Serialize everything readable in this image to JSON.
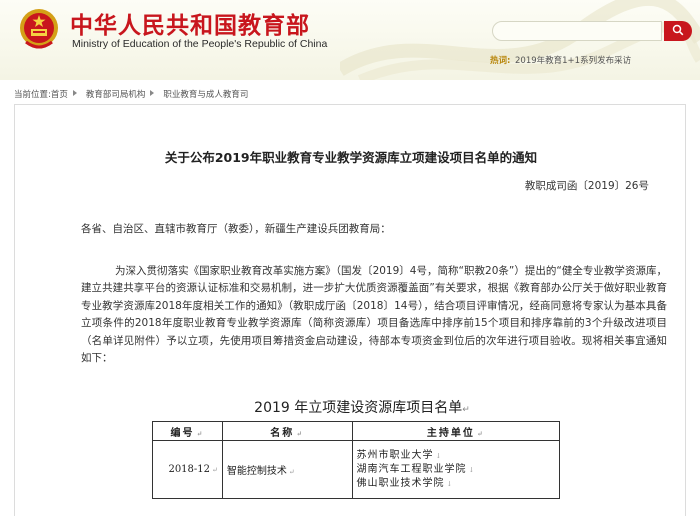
{
  "header": {
    "title_cn": "中华人民共和国教育部",
    "title_en": "Ministry of Education of the People's Republic of China",
    "search": {
      "value": "",
      "placeholder": ""
    },
    "hot_label": "热词:",
    "hot_link": "2019年教育1+1系列发布采访"
  },
  "breadcrumb": {
    "prefix": "当前位置:",
    "items": [
      "首页",
      "教育部司局机构",
      "职业教育与成人教育司"
    ]
  },
  "article": {
    "title": "关于公布2019年职业教育专业教学资源库立项建设项目名单的通知",
    "doc_number": "教职成司函〔2019〕26号",
    "salutation": "各省、自治区、直辖市教育厅（教委），新疆生产建设兵团教育局：",
    "body": "为深入贯彻落实《国家职业教育改革实施方案》（国发〔2019〕4号，简称“职教20条”）提出的“健全专业教学资源库，建立共建共享平台的资源认证标准和交易机制，进一步扩大优质资源覆盖面”有关要求，根据《教育部办公厅关于做好职业教育专业教学资源库2018年度相关工作的通知》（教职成厅函〔2018〕14号），结合项目评审情况，经商同意将专家认为基本具备立项条件的2018年度职业教育专业教学资源库（简称资源库）项目备选库中排序前15个项目和排序靠前的3个升级改进项目（名单详见附件）予以立项，先使用项目筹措资金启动建设，待部本专项资金到位后的次年进行项目验收。现将相关事宜通知如下："
  },
  "embed": {
    "caption": "2019 年立项建设资源库项目名单",
    "caption_mark": "↵",
    "cell_mark": "↵",
    "headers": [
      "编号",
      "名称",
      "主持单位"
    ],
    "rows": [
      {
        "code": "2018-12",
        "name": "智能控制技术",
        "hosts": [
          "苏州市职业大学",
          "湖南汽车工程职业学院",
          "佛山职业技术学院"
        ],
        "host_mark": "↓"
      }
    ]
  },
  "colors": {
    "brand_red": "#c8161d",
    "hot_gold": "#b8860b",
    "header_bg": "#f4f4e4"
  },
  "icons": [
    "national-emblem-icon",
    "search-icon",
    "breadcrumb-arrow-icon",
    "header-swirl-decoration"
  ]
}
